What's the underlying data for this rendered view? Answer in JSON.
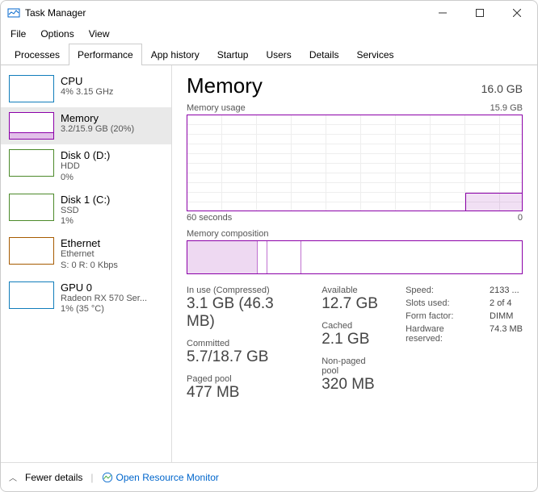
{
  "window": {
    "title": "Task Manager"
  },
  "menu": {
    "file": "File",
    "options": "Options",
    "view": "View"
  },
  "tabs": {
    "processes": "Processes",
    "performance": "Performance",
    "appHistory": "App history",
    "startup": "Startup",
    "users": "Users",
    "details": "Details",
    "services": "Services"
  },
  "sidebar": [
    {
      "title": "CPU",
      "sub": "4% 3.15 GHz",
      "thumb": "cpu"
    },
    {
      "title": "Memory",
      "sub": "3.2/15.9 GB (20%)",
      "thumb": "mem"
    },
    {
      "title": "Disk 0 (D:)",
      "sub": "HDD\n0%",
      "thumb": "disk"
    },
    {
      "title": "Disk 1 (C:)",
      "sub": "SSD\n1%",
      "thumb": "disk"
    },
    {
      "title": "Ethernet",
      "sub": "Ethernet\nS: 0 R: 0 Kbps",
      "thumb": "eth"
    },
    {
      "title": "GPU 0",
      "sub": "Radeon RX 570 Ser...\n1% (35 °C)",
      "thumb": "cpu"
    }
  ],
  "main": {
    "title": "Memory",
    "capacity": "16.0 GB",
    "chartLabelLeft": "Memory usage",
    "chartLabelRight": "15.9 GB",
    "xLeft": "60 seconds",
    "xRight": "0",
    "compLabel": "Memory composition",
    "stats": {
      "inUseLbl": "In use (Compressed)",
      "inUse": "3.1 GB (46.3 MB)",
      "availableLbl": "Available",
      "available": "12.7 GB",
      "committedLbl": "Committed",
      "committed": "5.7/18.7 GB",
      "cachedLbl": "Cached",
      "cached": "2.1 GB",
      "pagedLbl": "Paged pool",
      "paged": "477 MB",
      "nonpagedLbl": "Non-paged pool",
      "nonpaged": "320 MB"
    },
    "details": {
      "speedLbl": "Speed:",
      "speed": "2133 ...",
      "slotsLbl": "Slots used:",
      "slots": "2 of 4",
      "formLbl": "Form factor:",
      "form": "DIMM",
      "hwresLbl": "Hardware reserved:",
      "hwres": "74.3 MB"
    }
  },
  "footer": {
    "fewer": "Fewer details",
    "resmon": "Open Resource Monitor"
  },
  "chart_data": {
    "type": "line",
    "title": "Memory usage",
    "xlabel": "60 seconds",
    "ylabel": "",
    "ylim": [
      0,
      15.9
    ],
    "x_range": [
      "60 seconds",
      "0"
    ],
    "series": [
      {
        "name": "Memory usage (GB)",
        "values_estimate": "approximately 3.1–3.2 GB flat across 60s"
      }
    ],
    "composition": {
      "in_use_gb": 3.1,
      "compressed_mb": 46.3,
      "available_gb": 12.7,
      "cached_gb": 2.1
    }
  }
}
